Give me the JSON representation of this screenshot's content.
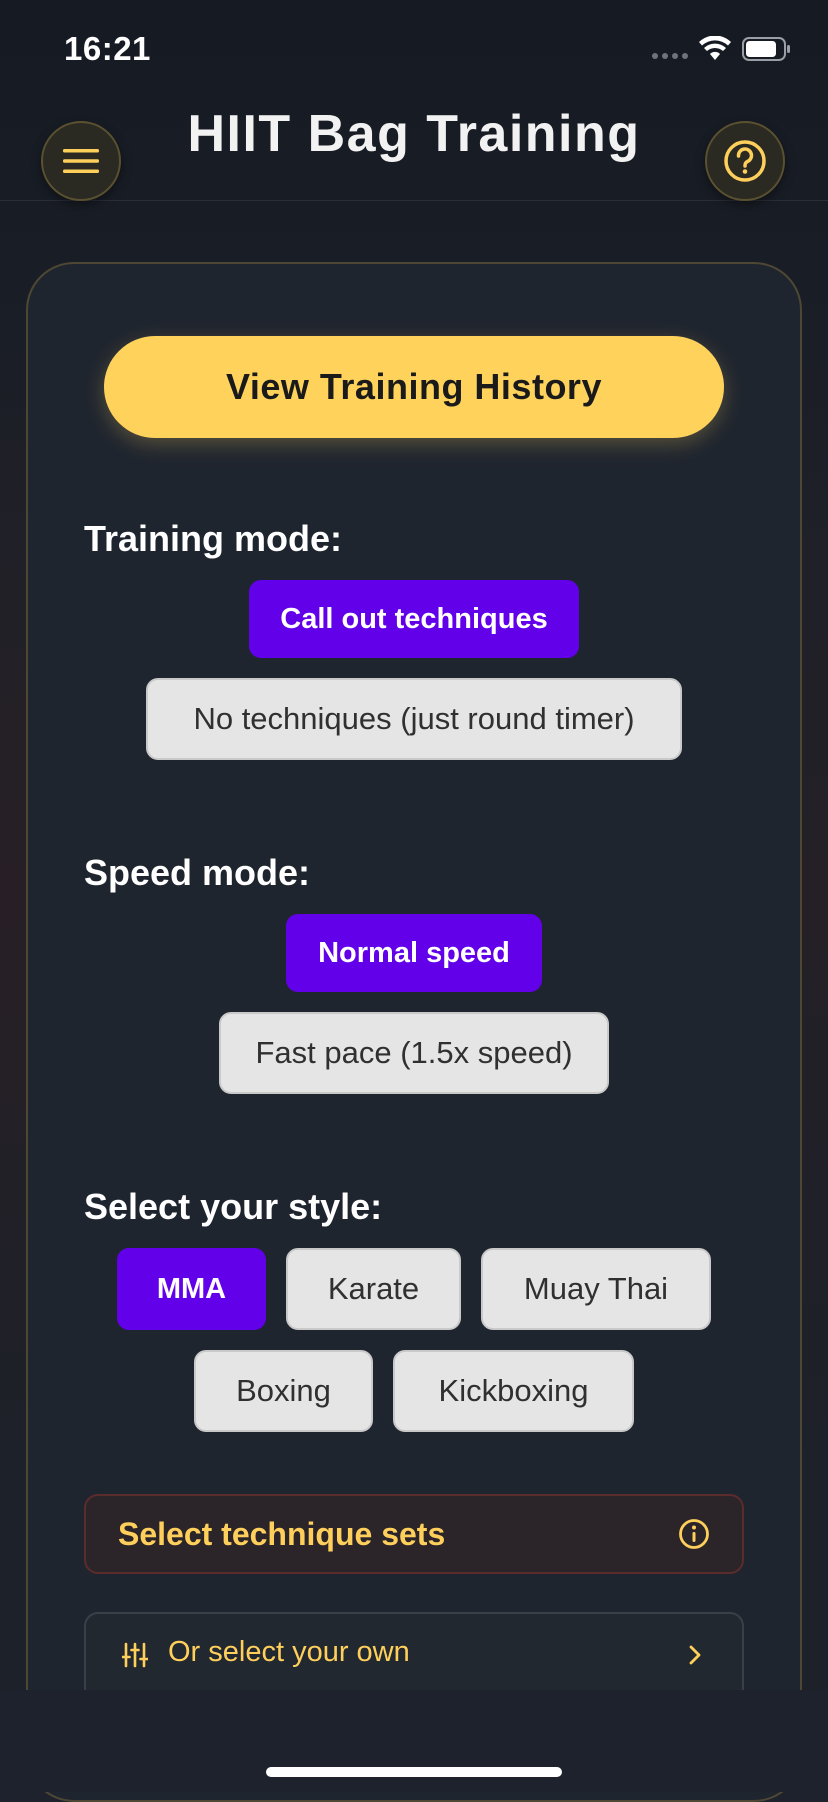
{
  "status_bar": {
    "time": "16:21"
  },
  "header": {
    "title": "HIIT Bag Training",
    "menu_icon": "hamburger-menu-icon",
    "help_icon": "question-circle-icon"
  },
  "history_button": {
    "label": "View Training History"
  },
  "training_mode": {
    "label": "Training mode:",
    "options": [
      {
        "label": "Call out techniques",
        "selected": true
      },
      {
        "label": "No techniques (just round timer)",
        "selected": false
      }
    ]
  },
  "speed_mode": {
    "label": "Speed mode:",
    "options": [
      {
        "label": "Normal speed",
        "selected": true
      },
      {
        "label": "Fast pace (1.5x speed)",
        "selected": false
      }
    ]
  },
  "style": {
    "label": "Select your style:",
    "options": [
      {
        "label": "MMA",
        "selected": true
      },
      {
        "label": "Karate",
        "selected": false
      },
      {
        "label": "Muay Thai",
        "selected": false
      },
      {
        "label": "Boxing",
        "selected": false
      },
      {
        "label": "Kickboxing",
        "selected": false
      }
    ]
  },
  "technique_sets": {
    "label": "Select technique sets",
    "icon": "info-icon"
  },
  "select_own": {
    "label": "Or select your own",
    "icon": "sliders-icon",
    "chevron": "chevron-right-icon"
  },
  "colors": {
    "accent_yellow": "#ffd25c",
    "selected_purple": "#6200ea",
    "background": "#1d222c"
  }
}
